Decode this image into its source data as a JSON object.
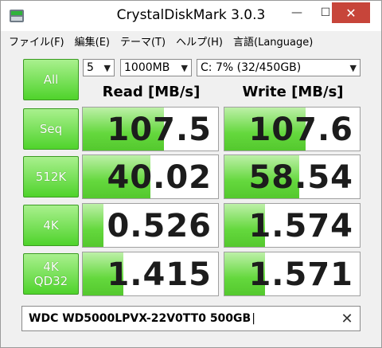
{
  "window": {
    "title": "CrystalDiskMark 3.0.3",
    "min_glyph": "—",
    "max_glyph": "☐",
    "close_glyph": "✕"
  },
  "menu": [
    "ファイル(F)",
    "編集(E)",
    "テーマ(T)",
    "ヘルプ(H)",
    "言語(Language)"
  ],
  "controls": {
    "all_label": "All",
    "count": "5",
    "size": "1000MB",
    "drive": "C: 7% (32/450GB)"
  },
  "headers": {
    "read": "Read [MB/s]",
    "write": "Write [MB/s]"
  },
  "tests": [
    {
      "label": "Seq",
      "read": "107.5",
      "write": "107.6",
      "read_fill": 0.6,
      "write_fill": 0.6
    },
    {
      "label": "512K",
      "read": "40.02",
      "write": "58.54",
      "read_fill": 0.5,
      "write_fill": 0.55
    },
    {
      "label": "4K",
      "read": "0.526",
      "write": "1.574",
      "read_fill": 0.15,
      "write_fill": 0.3
    },
    {
      "label": "4K QD32",
      "label_line1": "4K",
      "label_line2": "QD32",
      "read": "1.415",
      "write": "1.571",
      "read_fill": 0.3,
      "write_fill": 0.3
    }
  ],
  "comment": {
    "value": "WDC WD5000LPVX-22V0TT0 500GB",
    "clear_glyph": "✕"
  },
  "colors": {
    "accent_green": "#4fd32b",
    "close_red": "#c7453a"
  }
}
